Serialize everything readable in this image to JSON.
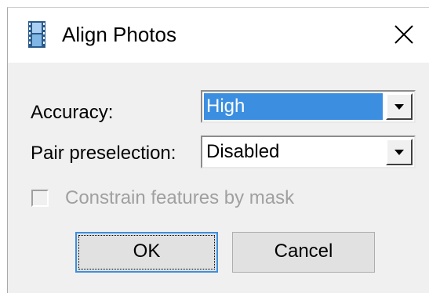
{
  "window": {
    "title": "Align Photos",
    "icon": "film-strip-icon",
    "close_icon": "close-icon"
  },
  "form": {
    "accuracy": {
      "label": "Accuracy:",
      "value": "High",
      "highlighted": true
    },
    "pair_preselection": {
      "label": "Pair preselection:",
      "value": "Disabled"
    },
    "constrain_by_mask": {
      "label": "Constrain features by mask",
      "checked": false,
      "enabled": false
    }
  },
  "buttons": {
    "ok": "OK",
    "cancel": "Cancel"
  },
  "colors": {
    "selection": "#3c8fe0",
    "dialog_bg": "#f0f0f0",
    "disabled_text": "#a0a0a0"
  }
}
